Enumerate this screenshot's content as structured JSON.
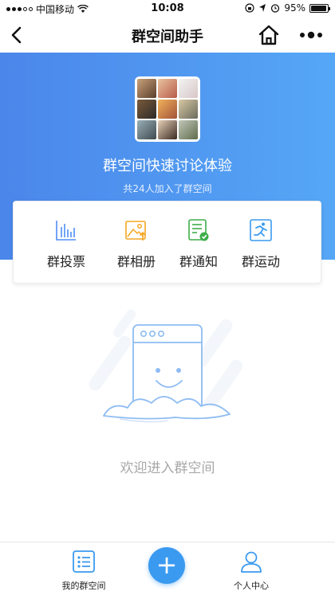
{
  "status_bar": {
    "carrier": "中国移动",
    "time": "10:08",
    "battery": "95%",
    "battery_level": 0.95
  },
  "nav": {
    "title": "群空间助手",
    "back_icon": "chevron-left-icon",
    "home_icon": "home-icon",
    "more_icon": "more-dots-icon"
  },
  "hero": {
    "title": "群空间快速讨论体验",
    "subtitle": "共24人加入了群空间",
    "gradient": [
      "#4b86ea",
      "#55a7f6"
    ]
  },
  "features": [
    {
      "label": "群投票",
      "icon": "bar-chart-icon",
      "color": "#4f8ef7"
    },
    {
      "label": "群相册",
      "icon": "photo-icon",
      "color": "#f5a623"
    },
    {
      "label": "群通知",
      "icon": "notice-icon",
      "color": "#3fae4a"
    },
    {
      "label": "群运动",
      "icon": "run-icon",
      "color": "#3a9af0"
    }
  ],
  "empty": {
    "text": "欢迎进入群空间"
  },
  "tab_bar": {
    "left": {
      "label": "我的群空间",
      "icon": "list-icon"
    },
    "center": {
      "icon": "plus-icon",
      "glyph": "+"
    },
    "right": {
      "label": "个人中心",
      "icon": "person-icon"
    },
    "accent": "#3a9af0"
  }
}
